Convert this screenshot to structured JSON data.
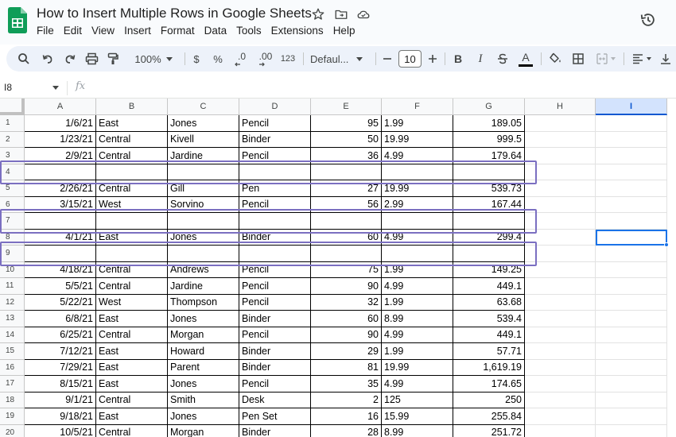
{
  "app": {
    "title": "How to Insert Multiple Rows in Google Sheets",
    "menu": [
      "File",
      "Edit",
      "View",
      "Insert",
      "Format",
      "Data",
      "Tools",
      "Extensions",
      "Help"
    ],
    "accent_color": "#0f9d58"
  },
  "toolbar": {
    "zoom": "100%",
    "currency": "$",
    "percent": "%",
    "dec_decrease": ".0",
    "dec_increase": ".00",
    "number_format": "123",
    "font": "Defaul...",
    "font_size": "10",
    "bold": "B",
    "italic": "I",
    "text_color": "A"
  },
  "formula_bar": {
    "name_box": "I8",
    "fx_label": "fx"
  },
  "grid": {
    "columns": [
      "A",
      "B",
      "C",
      "D",
      "E",
      "F",
      "G",
      "H",
      "I"
    ],
    "selected_column": "I",
    "selected_cell": "I8",
    "inserted_rows": [
      4,
      7,
      9
    ],
    "inserted_row_highlight_color": "#7b6fc1",
    "row_numbers": [
      1,
      2,
      3,
      4,
      5,
      6,
      7,
      8,
      9,
      10,
      11,
      12,
      13,
      14,
      15,
      16,
      17,
      18,
      19,
      20
    ],
    "rows": [
      [
        "1/6/21",
        "East",
        "Jones",
        "Pencil",
        "95",
        "1.99",
        "189.05"
      ],
      [
        "1/23/21",
        "Central",
        "Kivell",
        "Binder",
        "50",
        "19.99",
        "999.5"
      ],
      [
        "2/9/21",
        "Central",
        "Jardine",
        "Pencil",
        "36",
        "4.99",
        "179.64"
      ],
      [
        "",
        "",
        "",
        "",
        "",
        "",
        ""
      ],
      [
        "2/26/21",
        "Central",
        "Gill",
        "Pen",
        "27",
        "19.99",
        "539.73"
      ],
      [
        "3/15/21",
        "West",
        "Sorvino",
        "Pencil",
        "56",
        "2.99",
        "167.44"
      ],
      [
        "",
        "",
        "",
        "",
        "",
        "",
        ""
      ],
      [
        "4/1/21",
        "East",
        "Jones",
        "Binder",
        "60",
        "4.99",
        "299.4"
      ],
      [
        "",
        "",
        "",
        "",
        "",
        "",
        ""
      ],
      [
        "4/18/21",
        "Central",
        "Andrews",
        "Pencil",
        "75",
        "1.99",
        "149.25"
      ],
      [
        "5/5/21",
        "Central",
        "Jardine",
        "Pencil",
        "90",
        "4.99",
        "449.1"
      ],
      [
        "5/22/21",
        "West",
        "Thompson",
        "Pencil",
        "32",
        "1.99",
        "63.68"
      ],
      [
        "6/8/21",
        "East",
        "Jones",
        "Binder",
        "60",
        "8.99",
        "539.4"
      ],
      [
        "6/25/21",
        "Central",
        "Morgan",
        "Pencil",
        "90",
        "4.99",
        "449.1"
      ],
      [
        "7/12/21",
        "East",
        "Howard",
        "Binder",
        "29",
        "1.99",
        "57.71"
      ],
      [
        "7/29/21",
        "East",
        "Parent",
        "Binder",
        "81",
        "19.99",
        "1,619.19"
      ],
      [
        "8/15/21",
        "East",
        "Jones",
        "Pencil",
        "35",
        "4.99",
        "174.65"
      ],
      [
        "9/1/21",
        "Central",
        "Smith",
        "Desk",
        "2",
        "125",
        "250"
      ],
      [
        "9/18/21",
        "East",
        "Jones",
        "Pen Set",
        "16",
        "15.99",
        "255.84"
      ],
      [
        "10/5/21",
        "Central",
        "Morgan",
        "Binder",
        "28",
        "8.99",
        "251.72"
      ]
    ]
  }
}
